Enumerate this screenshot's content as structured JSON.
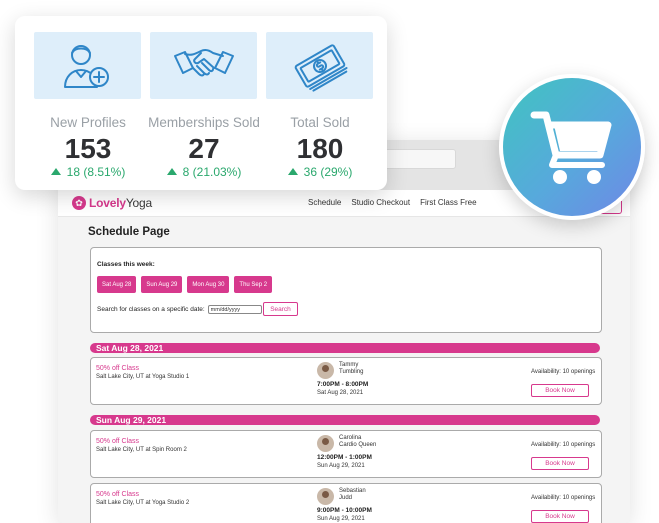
{
  "stats": [
    {
      "label": "New Profiles",
      "value": "153",
      "change": "18 (8.51%)",
      "icon": "user-add-icon"
    },
    {
      "label": "Memberships Sold",
      "value": "27",
      "change": "8 (21.03%)",
      "icon": "handshake-icon"
    },
    {
      "label": "Total Sold",
      "value": "180",
      "change": "36 (29%)",
      "icon": "money-icon"
    }
  ],
  "cart_icon": "shopping-cart-icon",
  "colors": {
    "brand": "#d7398d",
    "positive": "#2aa86d",
    "tile": "#deeefa",
    "icon": "#2f86c8"
  },
  "app": {
    "logo_main": "Lovely",
    "logo_sub": "Yoga",
    "nav": [
      "Schedule",
      "Studio Checkout",
      "First Class Free"
    ],
    "page_title": "Schedule Page",
    "filter": {
      "label": "Classes this week:",
      "days": [
        "Sat Aug 28",
        "Sun Aug 29",
        "Mon Aug 30",
        "Thu Sep 2"
      ],
      "search_label": "Search for classes on a specific date:",
      "date_placeholder": "mm/dd/yyyy",
      "search_button": "Search"
    },
    "days": [
      {
        "header": "Sat Aug 28, 2021",
        "classes": [
          {
            "title": "50% off Class",
            "location": "Salt Lake City, UT at Yoga Studio 1",
            "instructor_first": "Tammy",
            "instructor_last": "Tumbling",
            "time": "7:00PM - 8:00PM",
            "date": "Sat Aug 28, 2021",
            "availability": "Availability: 10 openings",
            "book": "Book Now"
          }
        ]
      },
      {
        "header": "Sun Aug 29, 2021",
        "classes": [
          {
            "title": "50% off Class",
            "location": "Salt Lake City, UT at Spin Room 2",
            "instructor_first": "Carolina",
            "instructor_last": "Cardio Queen",
            "time": "12:00PM - 1:00PM",
            "date": "Sun Aug 29, 2021",
            "availability": "Availability: 10 openings",
            "book": "Book Now"
          },
          {
            "title": "50% off Class",
            "location": "Salt Lake City, UT at Yoga Studio 2",
            "instructor_first": "Sebastian",
            "instructor_last": "Judd",
            "time": "9:00PM - 10:00PM",
            "date": "Sun Aug 29, 2021",
            "availability": "Availability: 10 openings",
            "book": "Book Now"
          }
        ]
      }
    ]
  }
}
